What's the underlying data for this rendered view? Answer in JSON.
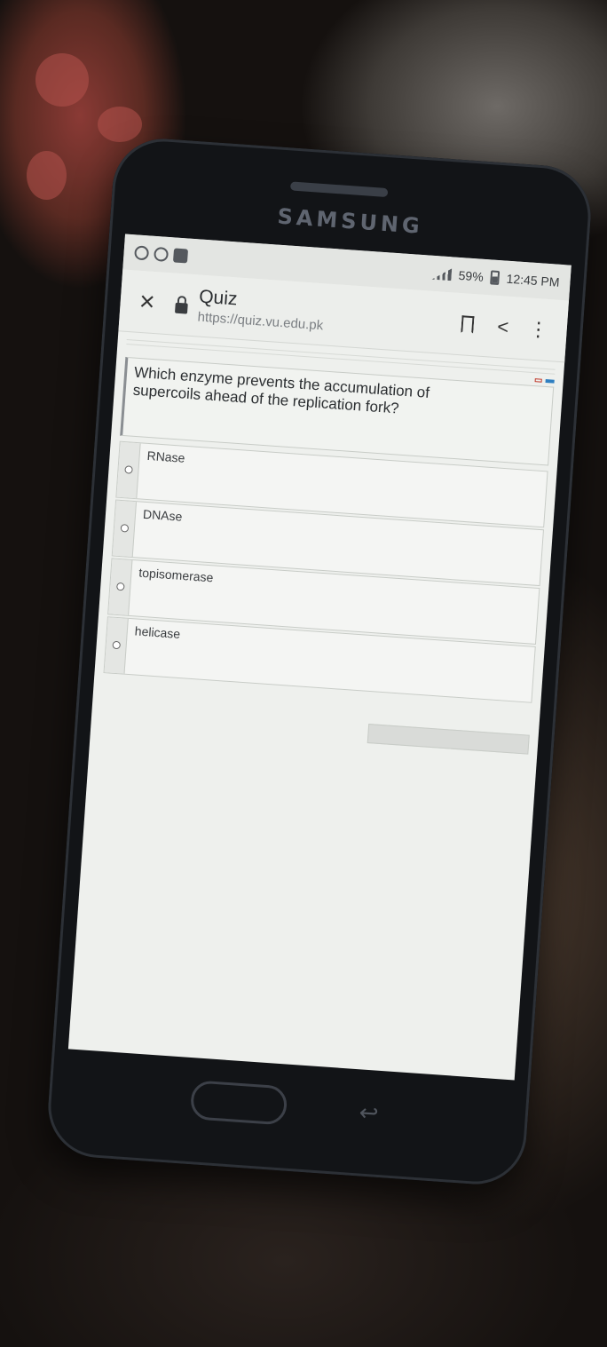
{
  "device": {
    "brand": "SAMSUNG"
  },
  "status_bar": {
    "battery": "59%",
    "time": "12:45 PM"
  },
  "browser": {
    "title": "Quiz",
    "url": "https://quiz.vu.edu.pk"
  },
  "quiz": {
    "question": "Which enzyme prevents the accumulation of supercoils ahead of the replication fork?",
    "options": [
      {
        "label": "RNase"
      },
      {
        "label": "DNAse"
      },
      {
        "label": "topisomerase"
      },
      {
        "label": "helicase"
      }
    ]
  },
  "icons": {
    "close": "close-icon",
    "lock": "lock-icon",
    "bookmark": "bookmark-icon",
    "share": "share-icon",
    "menu": "more-vert-icon"
  }
}
